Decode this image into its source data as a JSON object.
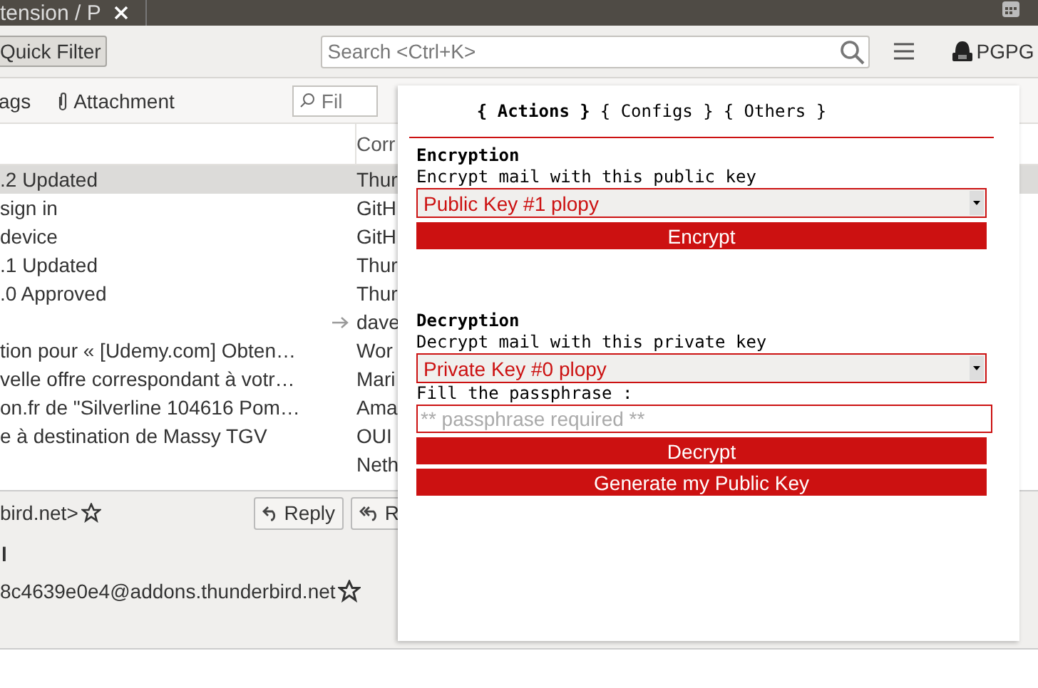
{
  "tab": {
    "title": "tension / P"
  },
  "toolbar": {
    "quick_filter": "Quick Filter",
    "search": {
      "placeholder": "Search <Ctrl+K>"
    },
    "addon": "PGPG"
  },
  "filter_bar": {
    "tags": "ags",
    "attachment": "Attachment",
    "filter": {
      "placeholder": "Fil"
    }
  },
  "columns": [
    "Corr"
  ],
  "messages": [
    {
      "subject": ".2 Updated",
      "correspondent": "Thur",
      "selected": true,
      "arrow": false
    },
    {
      "subject": "sign in",
      "correspondent": "GitH",
      "selected": false,
      "arrow": false
    },
    {
      "subject": "device",
      "correspondent": "GitH",
      "selected": false,
      "arrow": false
    },
    {
      "subject": ".1 Updated",
      "correspondent": "Thur",
      "selected": false,
      "arrow": false
    },
    {
      "subject": ".0 Approved",
      "correspondent": "Thur",
      "selected": false,
      "arrow": false
    },
    {
      "correspondent": "dave",
      "selected": false,
      "arrow": true
    },
    {
      "subject": "tion pour « [Udemy.com] Obten…",
      "correspondent": "Wor",
      "selected": false,
      "arrow": false
    },
    {
      "subject": "velle offre correspondant à votr…",
      "correspondent": "Mari",
      "selected": false,
      "arrow": false
    },
    {
      "subject": "on.fr de \"Silverline 104616 Pom…",
      "correspondent": "Ama",
      "selected": false,
      "arrow": false
    },
    {
      "subject": "e à destination de Massy TGV",
      "correspondent": "OUI",
      "selected": false,
      "arrow": false
    },
    {
      "correspondent": "Neth",
      "selected": false,
      "arrow": false
    }
  ],
  "message_header": {
    "from": "bird.net>",
    "line_2": "l",
    "to": "8c4639e0e4@addons.thunderbird.net",
    "buttons": [
      {
        "kind": "reply",
        "label": "Reply"
      },
      {
        "kind": "reply-all",
        "label": "R"
      }
    ]
  },
  "popup": {
    "tabs": [
      {
        "label": "{ Actions }",
        "selected": true
      },
      {
        "label": "{ Configs }",
        "selected": false
      },
      {
        "label": "{ Others }",
        "selected": false
      }
    ],
    "encryption": {
      "title": "Encryption",
      "label": "Encrypt mail with this public key",
      "key": "Public Key #1 plopy",
      "button": "Encrypt"
    },
    "decryption": {
      "title": "Decryption",
      "label": "Decrypt mail with this private key",
      "key": "Private Key #0 plopy",
      "passphrase_label": "Fill the passphrase :",
      "passphrase": {
        "placeholder": "** passphrase required **"
      },
      "button": "Decrypt"
    },
    "generate_button": "Generate my Public Key"
  }
}
